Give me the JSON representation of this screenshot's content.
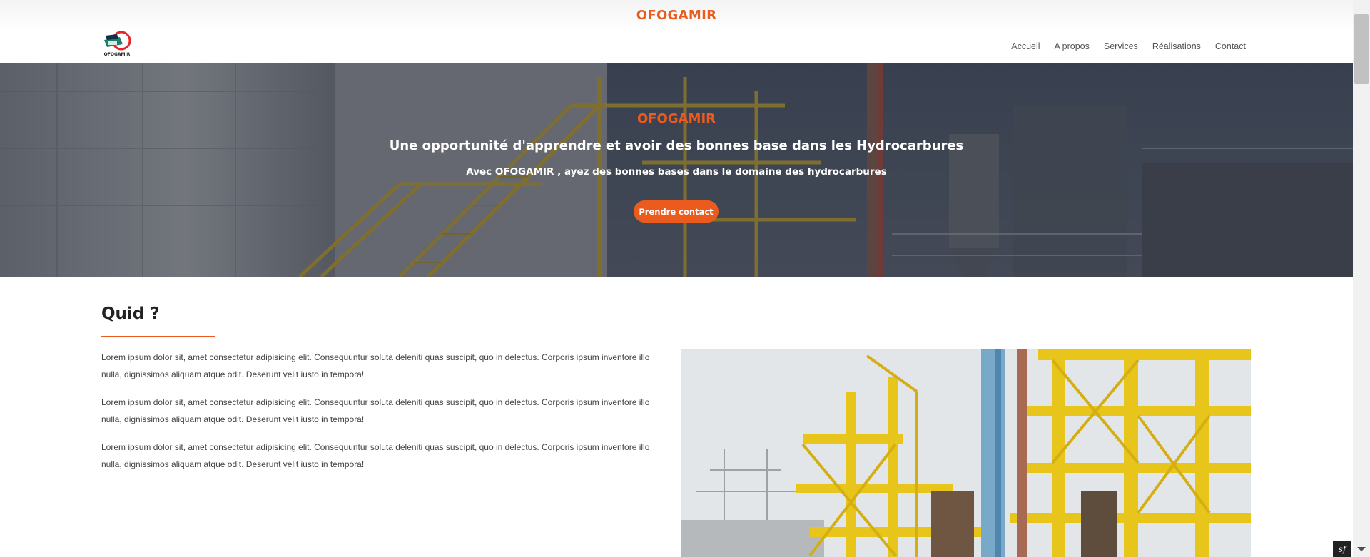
{
  "top_bar": {
    "brand": "OFOGAMIR"
  },
  "header": {
    "logo_text": "OFOGAMIR",
    "nav": [
      {
        "label": "Accueil"
      },
      {
        "label": "A propos"
      },
      {
        "label": "Services"
      },
      {
        "label": "Réalisations"
      },
      {
        "label": "Contact"
      }
    ]
  },
  "hero": {
    "brand": "OFOGAMIR",
    "title": "Une opportunité d'apprendre et avoir des bonnes base dans les Hydrocarbures",
    "subtitle": "Avec OFOGAMIR , ayez des bonnes bases dans le domaine des hydrocarbures",
    "cta_label": "Prendre contact"
  },
  "about": {
    "title": "Quid ?",
    "paragraphs": [
      "Lorem ipsum dolor sit, amet consectetur adipisicing elit. Consequuntur soluta deleniti quas suscipit, quo in delectus. Corporis ipsum inventore illo nulla, dignissimos aliquam atque odit. Deserunt velit iusto in tempora!",
      "Lorem ipsum dolor sit, amet consectetur adipisicing elit. Consequuntur soluta deleniti quas suscipit, quo in delectus. Corporis ipsum inventore illo nulla, dignissimos aliquam atque odit. Deserunt velit iusto in tempora!",
      "Lorem ipsum dolor sit, amet consectetur adipisicing elit. Consequuntur soluta deleniti quas suscipit, quo in delectus. Corporis ipsum inventore illo nulla, dignissimos aliquam atque odit. Deserunt velit iusto in tempora!"
    ]
  },
  "colors": {
    "accent": "#ea5b1d",
    "hero_overlay": "#232a38",
    "text": "#444444"
  },
  "icons": {
    "logo": "ofogamir-logo",
    "debug_toolbar": "symfony-icon",
    "scroll_down": "chevron-down-icon"
  }
}
